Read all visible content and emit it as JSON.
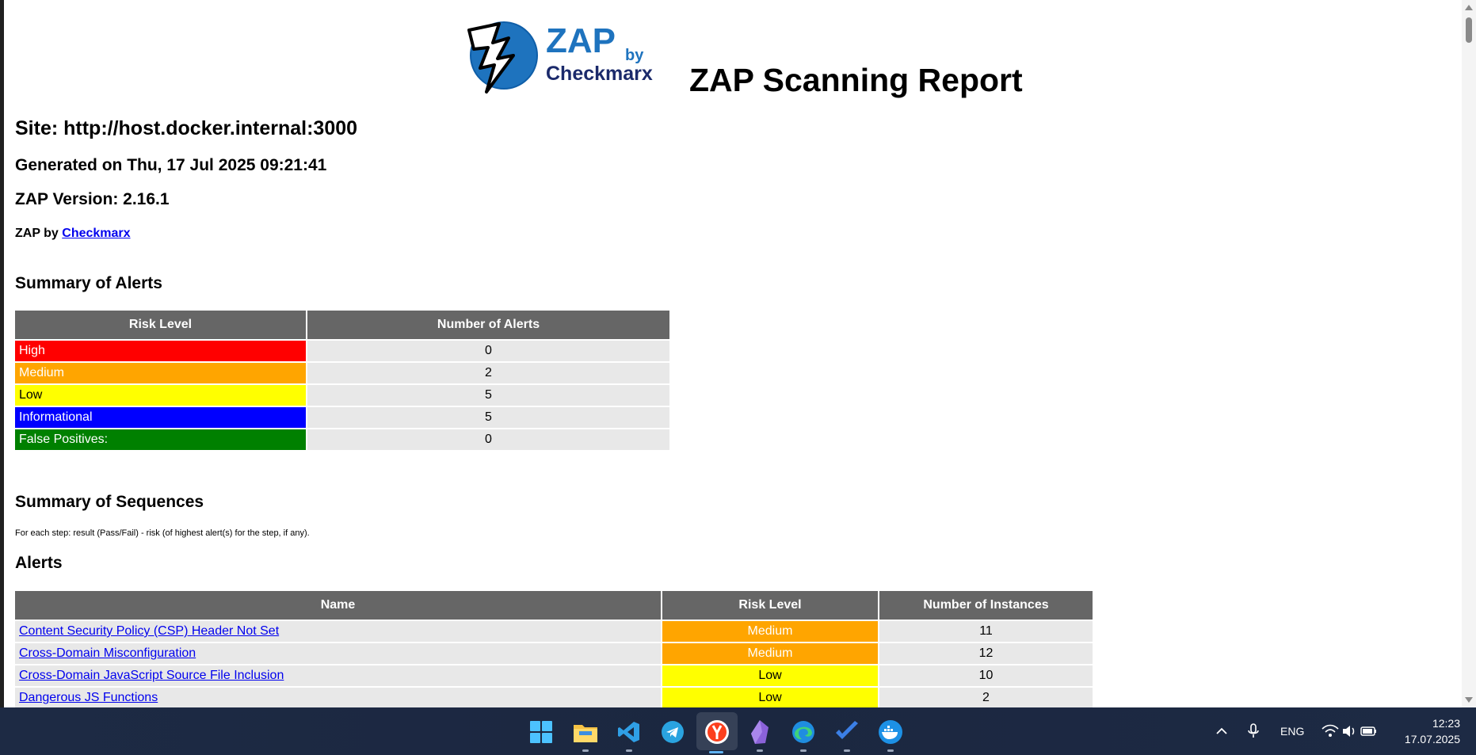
{
  "report": {
    "logo_zap": "ZAP",
    "logo_by": "by",
    "logo_brand": "Checkmarx",
    "title": "ZAP Scanning Report",
    "site": "Site: http://host.docker.internal:3000",
    "generated": "Generated on Thu, 17 Jul 2025 09:21:41",
    "version": "ZAP Version: 2.16.1",
    "byline_prefix": "ZAP by ",
    "byline_link": "Checkmarx"
  },
  "summary": {
    "heading": "Summary of Alerts",
    "col_risk": "Risk Level",
    "col_count": "Number of Alerts",
    "rows": [
      {
        "label": "High",
        "count": "0",
        "color": "#ff0000"
      },
      {
        "label": "Medium",
        "count": "2",
        "color": "#ffa500"
      },
      {
        "label": "Low",
        "count": "5",
        "color": "#ffff00"
      },
      {
        "label": "Informational",
        "count": "5",
        "color": "#0000ff"
      },
      {
        "label": "False Positives:",
        "count": "0",
        "color": "#008000"
      }
    ]
  },
  "sequences": {
    "heading": "Summary of Sequences",
    "note": "For each step: result (Pass/Fail) - risk (of highest alert(s) for the step, if any)."
  },
  "alerts": {
    "heading": "Alerts",
    "col_name": "Name",
    "col_risk": "Risk Level",
    "col_instances": "Number of Instances",
    "rows": [
      {
        "name": "Content Security Policy (CSP) Header Not Set",
        "risk": "Medium",
        "instances": "11"
      },
      {
        "name": "Cross-Domain Misconfiguration",
        "risk": "Medium",
        "instances": "12"
      },
      {
        "name": "Cross-Domain JavaScript Source File Inclusion",
        "risk": "Low",
        "instances": "10"
      },
      {
        "name": "Dangerous JS Functions",
        "risk": "Low",
        "instances": "2"
      }
    ]
  },
  "taskbar": {
    "icons": [
      "windows-start-icon",
      "file-explorer-icon",
      "vscode-icon",
      "telegram-icon",
      "yandex-browser-icon",
      "obsidian-icon",
      "edge-icon",
      "todo-icon",
      "docker-icon"
    ],
    "language": "ENG",
    "time": "12:23",
    "date": "17.07.2025"
  }
}
